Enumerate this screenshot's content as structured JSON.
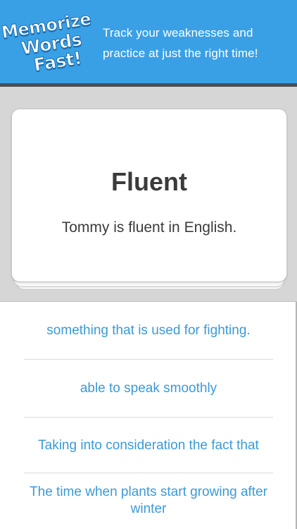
{
  "banner": {
    "logo_lines": [
      "Memorize",
      "Words",
      "Fast!"
    ],
    "tagline_lines": [
      "Track your weaknesses and",
      "practice at just the right time!"
    ],
    "color": "#3aa0e6"
  },
  "card": {
    "word": "Fluent",
    "sentence": "Tommy is fluent in English."
  },
  "options": [
    "something that is used for fighting.",
    "able to speak smoothly",
    "Taking into consideration the fact that",
    "The time when plants start growing after winter"
  ],
  "colors": {
    "option_text": "#3a9ad8",
    "card_text": "#3b3b3b"
  }
}
